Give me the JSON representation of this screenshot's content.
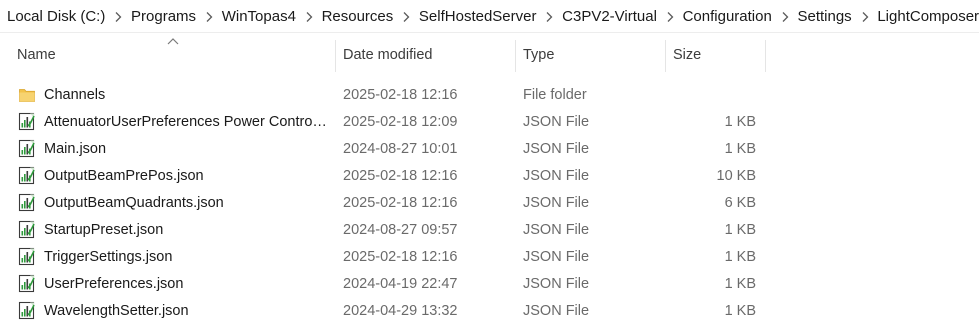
{
  "breadcrumb": [
    "Local Disk (C:)",
    "Programs",
    "WinTopas4",
    "Resources",
    "SelfHostedServer",
    "C3PV2-Virtual",
    "Configuration",
    "Settings",
    "LightComposer"
  ],
  "columns": {
    "name": "Name",
    "date": "Date modified",
    "type": "Type",
    "size": "Size"
  },
  "sort": {
    "column": "name",
    "direction": "ascending",
    "icon": "chevron-up-icon"
  },
  "files": [
    {
      "name": "Channels",
      "date": "2025-02-18 12:16",
      "type": "File folder",
      "size": "",
      "icon": "folder-icon"
    },
    {
      "name": "AttenuatorUserPreferences Power Control.json",
      "date": "2025-02-18 12:09",
      "type": "JSON File",
      "size": "1 KB",
      "icon": "json-file-icon"
    },
    {
      "name": "Main.json",
      "date": "2024-08-27 10:01",
      "type": "JSON File",
      "size": "1 KB",
      "icon": "json-file-icon"
    },
    {
      "name": "OutputBeamPrePos.json",
      "date": "2025-02-18 12:16",
      "type": "JSON File",
      "size": "10 KB",
      "icon": "json-file-icon"
    },
    {
      "name": "OutputBeamQuadrants.json",
      "date": "2025-02-18 12:16",
      "type": "JSON File",
      "size": "6 KB",
      "icon": "json-file-icon"
    },
    {
      "name": "StartupPreset.json",
      "date": "2024-08-27 09:57",
      "type": "JSON File",
      "size": "1 KB",
      "icon": "json-file-icon"
    },
    {
      "name": "TriggerSettings.json",
      "date": "2025-02-18 12:16",
      "type": "JSON File",
      "size": "1 KB",
      "icon": "json-file-icon"
    },
    {
      "name": "UserPreferences.json",
      "date": "2024-04-19 22:47",
      "type": "JSON File",
      "size": "1 KB",
      "icon": "json-file-icon"
    },
    {
      "name": "WavelengthSetter.json",
      "date": "2024-04-29 13:32",
      "type": "JSON File",
      "size": "1 KB",
      "icon": "json-file-icon"
    }
  ],
  "colors": {
    "folder": "#f3c34a",
    "json_icon_green": "#2e9a3c",
    "secondary_text": "#6a6a6a"
  }
}
